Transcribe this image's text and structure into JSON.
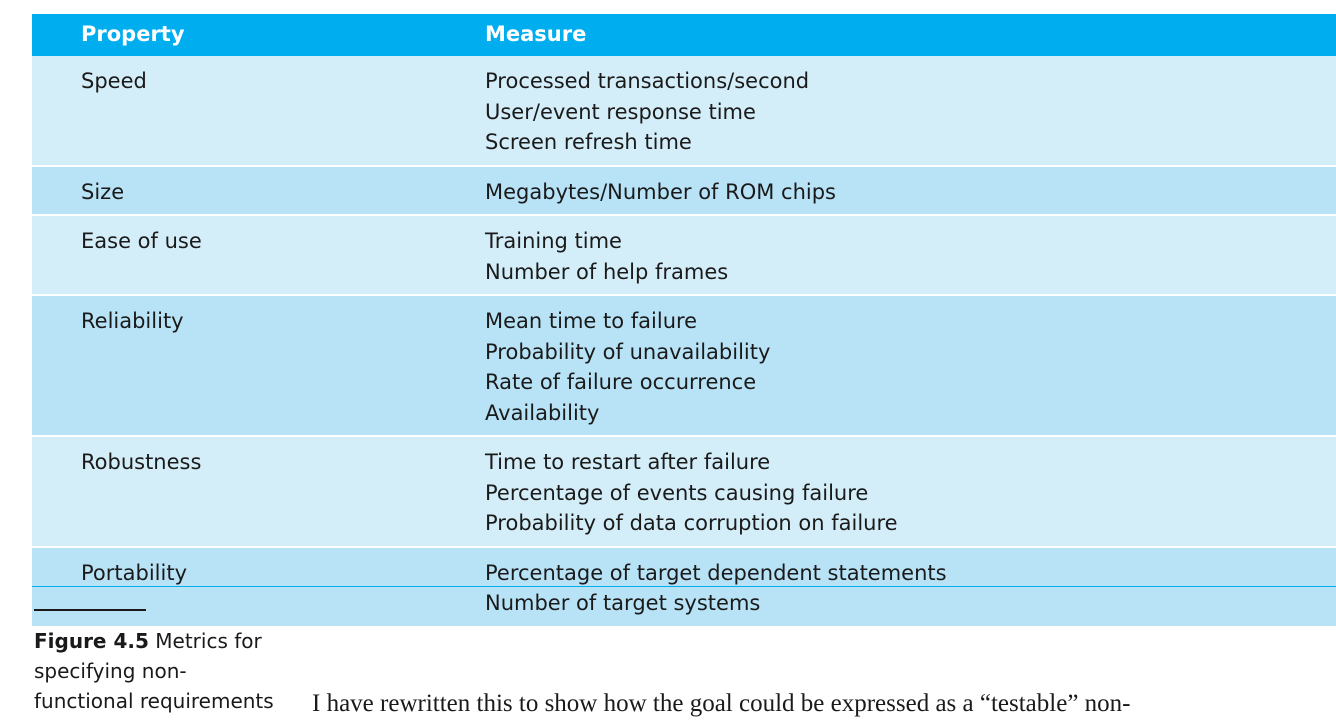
{
  "table": {
    "headers": {
      "property": "Property",
      "measure": "Measure"
    },
    "rows": [
      {
        "property": "Speed",
        "measures": [
          "Processed transactions/second",
          "User/event response time",
          "Screen refresh time"
        ]
      },
      {
        "property": "Size",
        "measures": [
          "Megabytes/Number of ROM chips"
        ]
      },
      {
        "property": "Ease of use",
        "measures": [
          "Training time",
          "Number of help frames"
        ]
      },
      {
        "property": "Reliability",
        "measures": [
          "Mean time to failure",
          "Probability of unavailability",
          "Rate of failure occurrence",
          "Availability"
        ]
      },
      {
        "property": "Robustness",
        "measures": [
          "Time to restart after failure",
          "Percentage of events causing failure",
          "Probability of data corruption on failure"
        ]
      },
      {
        "property": "Portability",
        "measures": [
          "Percentage of target dependent statements",
          "Number of target systems"
        ]
      }
    ]
  },
  "caption": {
    "label": "Figure 4.5",
    "text": "Metrics for specifying non-functional requirements"
  },
  "body_text": "I have rewritten this to show how the goal could be expressed as a “testable” non-",
  "colors": {
    "header_bg": "#00aeef",
    "row_light": "#d4eef9",
    "row_dark": "#b8e3f7"
  }
}
